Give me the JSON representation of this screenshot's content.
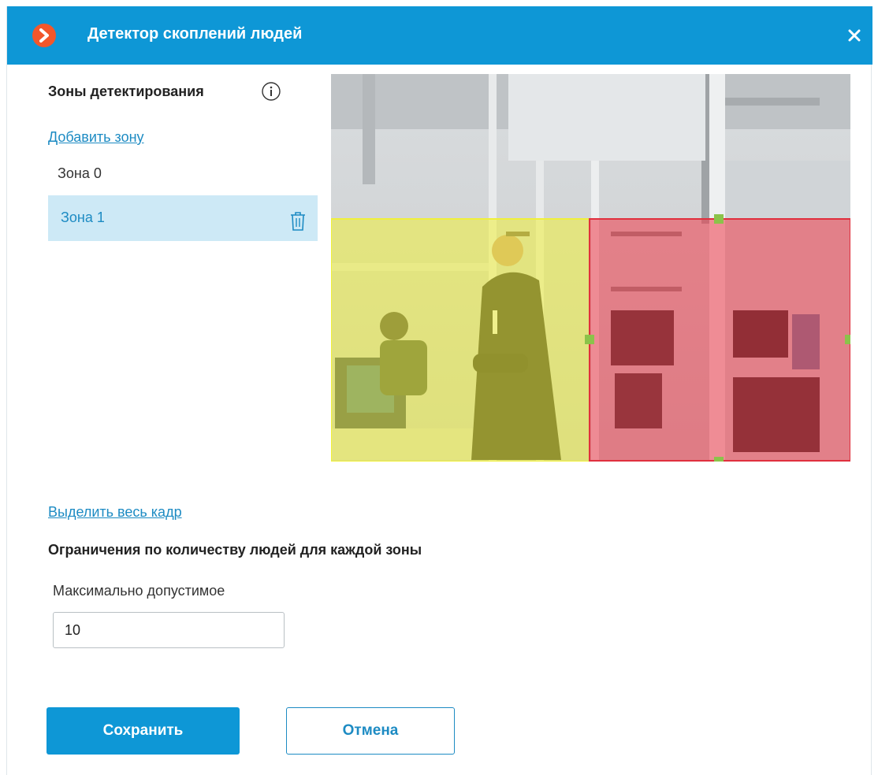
{
  "window": {
    "title": "Детектор скоплений людей",
    "accent_color": "#0e97d6",
    "logo_color": "#f2572b"
  },
  "zones_panel": {
    "heading": "Зоны детектирования",
    "add_zone_label": "Добавить зону",
    "zones": [
      {
        "label": "Зона 0",
        "selected": false,
        "overlay_color": "#f0f03a"
      },
      {
        "label": "Зона 1",
        "selected": true,
        "overlay_color": "#f03a48"
      }
    ]
  },
  "select_whole_frame_label": "Выделить весь кадр",
  "limits": {
    "heading": "Ограничения по количеству людей для каждой зоны",
    "max_label": "Максимально допустимое",
    "max_value": "10"
  },
  "buttons": {
    "save": "Сохранить",
    "cancel": "Отмена"
  }
}
